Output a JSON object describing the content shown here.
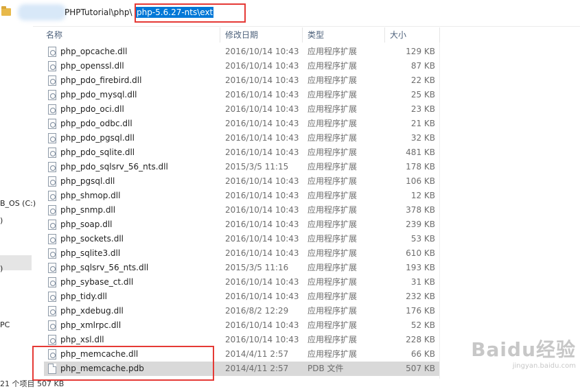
{
  "address": {
    "segment_prefix": "PHPTutorial\\php\\",
    "segment_selected": "php-5.6.27-nts\\ext"
  },
  "nav": {
    "items": [
      "B_OS (C:)",
      ")",
      ")",
      "PC"
    ]
  },
  "columns": {
    "name": "名称",
    "date": "修改日期",
    "type": "类型",
    "size": "大小"
  },
  "files": [
    {
      "name": "php_opcache.dll",
      "date": "2016/10/14 10:43",
      "type": "应用程序扩展",
      "size": "129 KB",
      "icon": "dll"
    },
    {
      "name": "php_openssl.dll",
      "date": "2016/10/14 10:43",
      "type": "应用程序扩展",
      "size": "87 KB",
      "icon": "dll"
    },
    {
      "name": "php_pdo_firebird.dll",
      "date": "2016/10/14 10:43",
      "type": "应用程序扩展",
      "size": "22 KB",
      "icon": "dll"
    },
    {
      "name": "php_pdo_mysql.dll",
      "date": "2016/10/14 10:43",
      "type": "应用程序扩展",
      "size": "25 KB",
      "icon": "dll"
    },
    {
      "name": "php_pdo_oci.dll",
      "date": "2016/10/14 10:43",
      "type": "应用程序扩展",
      "size": "23 KB",
      "icon": "dll"
    },
    {
      "name": "php_pdo_odbc.dll",
      "date": "2016/10/14 10:43",
      "type": "应用程序扩展",
      "size": "21 KB",
      "icon": "dll"
    },
    {
      "name": "php_pdo_pgsql.dll",
      "date": "2016/10/14 10:43",
      "type": "应用程序扩展",
      "size": "32 KB",
      "icon": "dll"
    },
    {
      "name": "php_pdo_sqlite.dll",
      "date": "2016/10/14 10:43",
      "type": "应用程序扩展",
      "size": "481 KB",
      "icon": "dll"
    },
    {
      "name": "php_pdo_sqlsrv_56_nts.dll",
      "date": "2015/3/5 11:15",
      "type": "应用程序扩展",
      "size": "178 KB",
      "icon": "dll"
    },
    {
      "name": "php_pgsql.dll",
      "date": "2016/10/14 10:43",
      "type": "应用程序扩展",
      "size": "106 KB",
      "icon": "dll"
    },
    {
      "name": "php_shmop.dll",
      "date": "2016/10/14 10:43",
      "type": "应用程序扩展",
      "size": "12 KB",
      "icon": "dll"
    },
    {
      "name": "php_snmp.dll",
      "date": "2016/10/14 10:43",
      "type": "应用程序扩展",
      "size": "378 KB",
      "icon": "dll"
    },
    {
      "name": "php_soap.dll",
      "date": "2016/10/14 10:43",
      "type": "应用程序扩展",
      "size": "239 KB",
      "icon": "dll"
    },
    {
      "name": "php_sockets.dll",
      "date": "2016/10/14 10:43",
      "type": "应用程序扩展",
      "size": "53 KB",
      "icon": "dll"
    },
    {
      "name": "php_sqlite3.dll",
      "date": "2016/10/14 10:43",
      "type": "应用程序扩展",
      "size": "610 KB",
      "icon": "dll"
    },
    {
      "name": "php_sqlsrv_56_nts.dll",
      "date": "2015/3/5 11:16",
      "type": "应用程序扩展",
      "size": "193 KB",
      "icon": "dll"
    },
    {
      "name": "php_sybase_ct.dll",
      "date": "2016/10/14 10:43",
      "type": "应用程序扩展",
      "size": "31 KB",
      "icon": "dll"
    },
    {
      "name": "php_tidy.dll",
      "date": "2016/10/14 10:43",
      "type": "应用程序扩展",
      "size": "232 KB",
      "icon": "dll"
    },
    {
      "name": "php_xdebug.dll",
      "date": "2016/8/2 12:29",
      "type": "应用程序扩展",
      "size": "176 KB",
      "icon": "dll"
    },
    {
      "name": "php_xmlrpc.dll",
      "date": "2016/10/14 10:43",
      "type": "应用程序扩展",
      "size": "52 KB",
      "icon": "dll"
    },
    {
      "name": "php_xsl.dll",
      "date": "2016/10/14 10:43",
      "type": "应用程序扩展",
      "size": "228 KB",
      "icon": "dll"
    },
    {
      "name": "php_memcache.dll",
      "date": "2014/4/11 2:57",
      "type": "应用程序扩展",
      "size": "66 KB",
      "icon": "dll"
    },
    {
      "name": "php_memcache.pdb",
      "date": "2014/4/11 2:57",
      "type": "PDB 文件",
      "size": "507 KB",
      "icon": "pdb",
      "selected": true
    }
  ],
  "status": {
    "text": "21 个项目   507 KB"
  },
  "watermark": {
    "brand": "Baidu经验",
    "url": "jingyan.baidu.com"
  },
  "colors": {
    "highlight_box": "#e53935",
    "selection_blue": "#0078d7",
    "selected_row": "#d9d9d9"
  }
}
